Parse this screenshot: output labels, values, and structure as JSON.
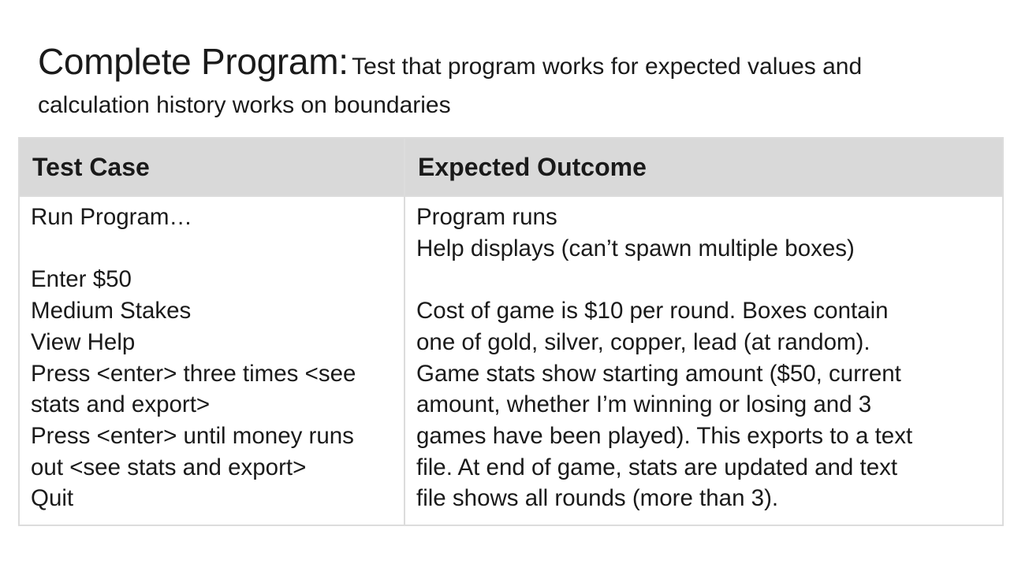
{
  "heading": {
    "title": "Complete Program:",
    "subtitle_line1": "Test that program works for expected values and",
    "subtitle_line2": "calculation history works on boundaries"
  },
  "table": {
    "headers": [
      "Test Case",
      "Expected Outcome"
    ],
    "test_case": {
      "l1": "Run Program…",
      "l2": "Enter $50",
      "l3": "Medium Stakes",
      "l4": "View Help",
      "l5": "Press <enter> three times <see",
      "l6": "stats and export>",
      "l7": "Press <enter> until money runs",
      "l8": "out <see stats and export>",
      "l9": "Quit"
    },
    "expected_outcome": {
      "l1": "Program runs",
      "l2": "Help displays (can’t spawn multiple boxes)",
      "l3": "Cost of game is $10 per round.  Boxes contain",
      "l4": "one of gold, silver, copper, lead (at random).",
      "l5": "Game stats show starting amount ($50, current",
      "l6": "amount, whether I’m winning or losing and 3",
      "l7": "games have been played).  This exports to a text",
      "l8": "file.  At end of game, stats are updated and text",
      "l9": "file shows all rounds (more than 3)."
    }
  }
}
